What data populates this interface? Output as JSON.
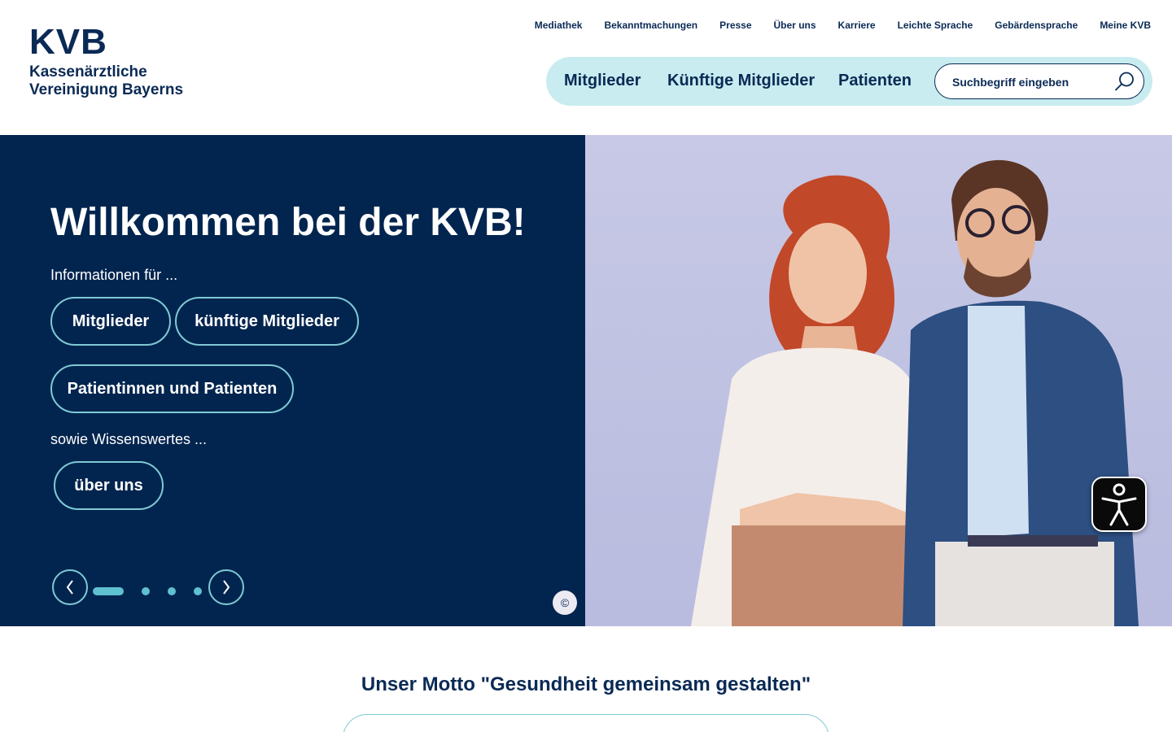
{
  "logo": {
    "mark": "KVB",
    "line1": "Kassenärztliche",
    "line2": "Vereinigung Bayerns"
  },
  "utility_nav": [
    "Mediathek",
    "Bekanntmachungen",
    "Presse",
    "Über uns",
    "Karriere",
    "Leichte Sprache",
    "Gebärdensprache",
    "Meine KVB"
  ],
  "main_nav": {
    "items": [
      "Mitglieder",
      "Künftige Mitglieder",
      "Patienten"
    ],
    "search_placeholder": "Suchbegriff eingeben",
    "search_icon": "search-icon"
  },
  "hero": {
    "title": "Willkommen bei der KVB!",
    "intro": "Informationen für ...",
    "buttons": [
      "Mitglieder",
      "künftige Mitglieder",
      "Patientinnen und Patienten"
    ],
    "more": "sowie Wissenswertes ...",
    "about_button": "über uns",
    "prev_icon": "chevron-left-icon",
    "next_icon": "chevron-right-icon",
    "slides_total": 4,
    "active_slide": 1,
    "accessibility_icon": "accessibility-icon",
    "copyright_symbol": "©"
  },
  "motto": {
    "title": "Unser Motto \"Gesundheit gemeinsam gestalten\""
  },
  "colors": {
    "primary": "#02254f",
    "accent": "#7fc9d4",
    "nav_bg": "#c8ecef",
    "photo_bg": "#c2c4e3"
  }
}
